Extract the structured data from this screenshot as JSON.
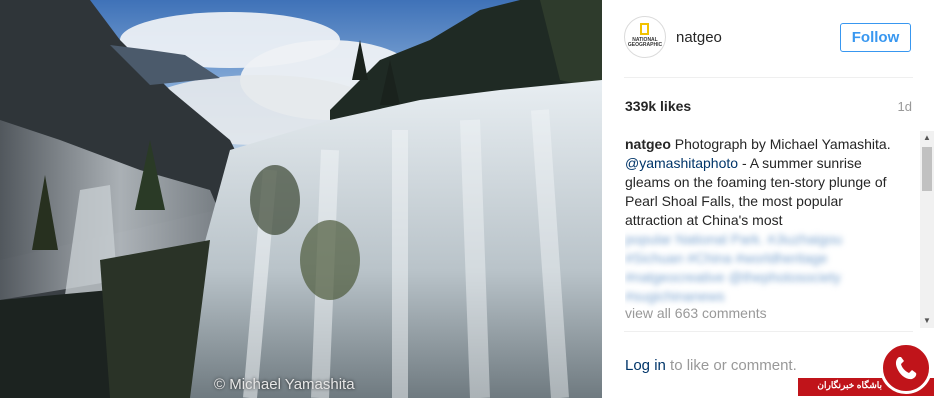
{
  "photo": {
    "description_icon": "waterfall-photo",
    "watermark": "© Michael Yamashita"
  },
  "post_header": {
    "avatar_logo_text": "NATIONAL GEOGRAPHIC",
    "username": "natgeo",
    "follow_label": "Follow"
  },
  "stats": {
    "likes": "339k likes",
    "time": "1d"
  },
  "caption": {
    "user": "natgeo",
    "text_before": " Photograph by Michael Yamashita. ",
    "mention": "@yamashitaphoto",
    "text_after": " - A summer sunrise gleams on the foaming ten-story plunge of Pearl Shoal Falls, the most popular attraction at China's most",
    "blurred_lines": [
      "popular National Park. #Jiuzhaigou",
      "#Sichuan #China #worldheritage",
      "#natgeocreative @thephotosociety",
      "#sugichinanews"
    ]
  },
  "comments": {
    "view_all": "view all 663 comments"
  },
  "footer": {
    "login_link": "Log in",
    "login_suffix": " to like or comment."
  },
  "badge": {
    "text": "باشگاه خبرنگاران",
    "icon": "phone-in-circle-icon"
  },
  "colors": {
    "accent": "#3897f0",
    "link": "#003569",
    "muted": "#999999",
    "badge_red": "#c0141a"
  }
}
